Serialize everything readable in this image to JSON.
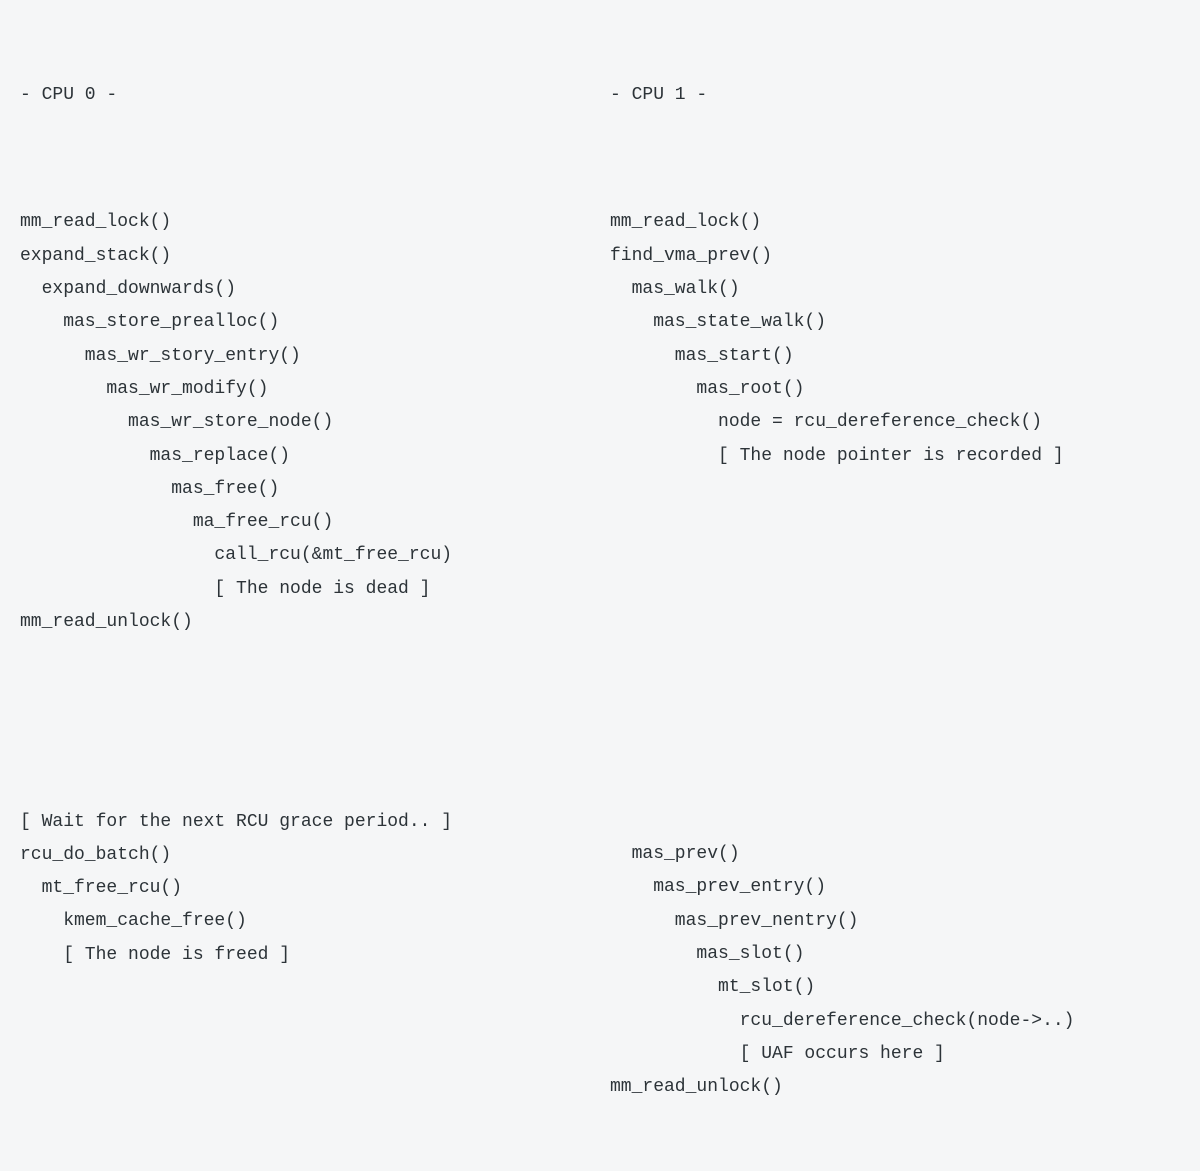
{
  "cpu0": {
    "header": "- CPU 0 -",
    "block1": "mm_read_lock()\nexpand_stack()\n  expand_downwards()\n    mas_store_prealloc()\n      mas_wr_story_entry()\n        mas_wr_modify()\n          mas_wr_store_node()\n            mas_replace()\n              mas_free()\n                ma_free_rcu()\n                  call_rcu(&mt_free_rcu)\n                  [ The node is dead ]\nmm_read_unlock()",
    "block2": "[ Wait for the next RCU grace period.. ]\nrcu_do_batch()\n  mt_free_rcu()\n    kmem_cache_free()\n    [ The node is freed ]"
  },
  "cpu1": {
    "header": "- CPU 1 -",
    "block1": "mm_read_lock()\nfind_vma_prev()\n  mas_walk()\n    mas_state_walk()\n      mas_start()\n        mas_root()\n          node = rcu_dereference_check()\n          [ The node pointer is recorded ]",
    "block2": "  mas_prev()\n    mas_prev_entry()\n      mas_prev_nentry()\n        mas_slot()\n          mt_slot()\n            rcu_dereference_check(node->..)\n            [ UAF occurs here ]\nmm_read_unlock()"
  }
}
